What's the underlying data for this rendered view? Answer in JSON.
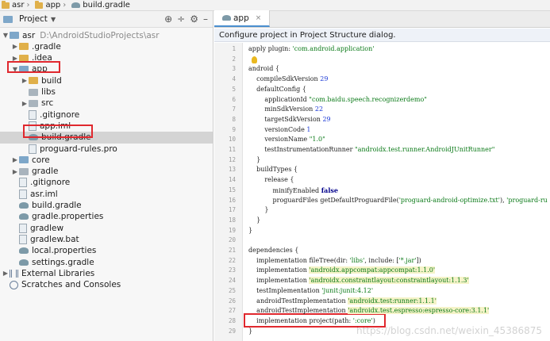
{
  "breadcrumb": [
    "asr",
    "app",
    "build.gradle"
  ],
  "project_panel": {
    "title": "Project",
    "tree": [
      {
        "label": "asr",
        "extra": "D:\\AndroidStudioProjects\\asr",
        "depth": 0,
        "arrow": "open",
        "icon": "module"
      },
      {
        "label": ".gradle",
        "depth": 1,
        "arrow": "closed",
        "icon": "folder"
      },
      {
        "label": ".idea",
        "depth": 1,
        "arrow": "closed",
        "icon": "folder"
      },
      {
        "label": "app",
        "depth": 1,
        "arrow": "open",
        "icon": "module"
      },
      {
        "label": "build",
        "depth": 2,
        "arrow": "closed",
        "icon": "folder"
      },
      {
        "label": "libs",
        "depth": 2,
        "arrow": "none",
        "icon": "folder-gray"
      },
      {
        "label": "src",
        "depth": 2,
        "arrow": "closed",
        "icon": "folder-gray"
      },
      {
        "label": ".gitignore",
        "depth": 2,
        "arrow": "none",
        "icon": "file"
      },
      {
        "label": "app.iml",
        "depth": 2,
        "arrow": "none",
        "icon": "file"
      },
      {
        "label": "build.gradle",
        "depth": 2,
        "arrow": "none",
        "icon": "gradle",
        "selected": true
      },
      {
        "label": "proguard-rules.pro",
        "depth": 2,
        "arrow": "none",
        "icon": "file"
      },
      {
        "label": "core",
        "depth": 1,
        "arrow": "closed",
        "icon": "module"
      },
      {
        "label": "gradle",
        "depth": 1,
        "arrow": "closed",
        "icon": "folder-gray"
      },
      {
        "label": ".gitignore",
        "depth": 1,
        "arrow": "none",
        "icon": "file"
      },
      {
        "label": "asr.iml",
        "depth": 1,
        "arrow": "none",
        "icon": "file"
      },
      {
        "label": "build.gradle",
        "depth": 1,
        "arrow": "none",
        "icon": "gradle"
      },
      {
        "label": "gradle.properties",
        "depth": 1,
        "arrow": "none",
        "icon": "gradle"
      },
      {
        "label": "gradlew",
        "depth": 1,
        "arrow": "none",
        "icon": "file"
      },
      {
        "label": "gradlew.bat",
        "depth": 1,
        "arrow": "none",
        "icon": "file"
      },
      {
        "label": "local.properties",
        "depth": 1,
        "arrow": "none",
        "icon": "gradle"
      },
      {
        "label": "settings.gradle",
        "depth": 1,
        "arrow": "none",
        "icon": "gradle"
      },
      {
        "label": "External Libraries",
        "depth": 0,
        "arrow": "closed",
        "icon": "lib"
      },
      {
        "label": "Scratches and Consoles",
        "depth": 0,
        "arrow": "none",
        "icon": "scratch"
      }
    ]
  },
  "editor": {
    "tab": "app",
    "banner": "Configure project in Project Structure dialog.",
    "lines": [
      [
        [
          "apply ",
          ""
        ],
        [
          "plugin",
          ""
        ],
        [
          ": ",
          ""
        ],
        [
          "'com.android.application'",
          "str"
        ]
      ],
      [],
      [
        [
          "android {",
          ""
        ]
      ],
      [
        [
          "    compileSdkVersion ",
          ""
        ],
        [
          "29",
          "num"
        ]
      ],
      [
        [
          "    defaultConfig {",
          ""
        ]
      ],
      [
        [
          "        applicationId ",
          ""
        ],
        [
          "\"com.baidu.speech.recognizerdemo\"",
          "str"
        ]
      ],
      [
        [
          "        minSdkVersion ",
          ""
        ],
        [
          "22",
          "num"
        ]
      ],
      [
        [
          "        targetSdkVersion ",
          ""
        ],
        [
          "29",
          "num"
        ]
      ],
      [
        [
          "        versionCode ",
          ""
        ],
        [
          "1",
          "num"
        ]
      ],
      [
        [
          "        versionName ",
          ""
        ],
        [
          "\"1.0\"",
          "str"
        ]
      ],
      [
        [
          "        testInstrumentationRunner ",
          ""
        ],
        [
          "\"androidx.test.runner.AndroidJUnitRunner\"",
          "str"
        ]
      ],
      [
        [
          "    }",
          ""
        ]
      ],
      [
        [
          "    buildTypes {",
          ""
        ]
      ],
      [
        [
          "        release {",
          ""
        ]
      ],
      [
        [
          "            minifyEnabled ",
          ""
        ],
        [
          "false",
          "kw"
        ]
      ],
      [
        [
          "            proguardFiles getDefaultProguardFile(",
          ""
        ],
        [
          "'proguard-android-optimize.txt'",
          "str"
        ],
        [
          "), ",
          ""
        ],
        [
          "'proguard-ru",
          "str"
        ]
      ],
      [
        [
          "        }",
          ""
        ]
      ],
      [
        [
          "    }",
          ""
        ]
      ],
      [
        [
          "}",
          ""
        ]
      ],
      [],
      [
        [
          "dependencies {",
          ""
        ]
      ],
      [
        [
          "    implementation fileTree(dir: ",
          ""
        ],
        [
          "'libs'",
          "str"
        ],
        [
          ", include: [",
          ""
        ],
        [
          "'*.jar'",
          "str"
        ],
        [
          "])",
          ""
        ]
      ],
      [
        [
          "    implementation ",
          ""
        ],
        [
          "'androidx.appcompat:appcompat:1.1.0'",
          "str hl"
        ]
      ],
      [
        [
          "    implementation ",
          ""
        ],
        [
          "'androidx.constraintlayout:constraintlayout:1.1.3'",
          "str hl"
        ]
      ],
      [
        [
          "    testImplementation ",
          ""
        ],
        [
          "'junit:junit:4.12'",
          "str"
        ]
      ],
      [
        [
          "    androidTestImplementation ",
          ""
        ],
        [
          "'androidx.test:runner:1.1.1'",
          "str hl"
        ]
      ],
      [
        [
          "    androidTestImplementation ",
          ""
        ],
        [
          "'androidx.test.espresso:espresso-core:3.1.1'",
          "str hl"
        ]
      ],
      [
        [
          "    implementation project(path: ",
          ""
        ],
        [
          "':core'",
          "str"
        ],
        [
          ")",
          ""
        ]
      ],
      [
        [
          "}",
          ""
        ]
      ]
    ]
  },
  "watermark": "https://blog.csdn.net/weixin_45386875"
}
